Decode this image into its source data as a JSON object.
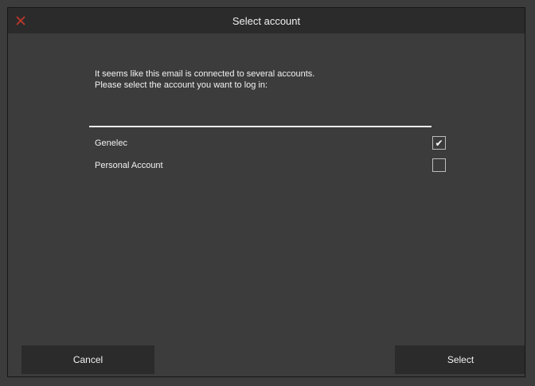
{
  "dialog": {
    "title": "Select account",
    "close_icon": "close-icon",
    "accent_close_color": "#c0392b"
  },
  "message": {
    "line1": "It seems like this email is connected to several accounts.",
    "line2": "Please select the account you want to log in:"
  },
  "accounts": [
    {
      "label": "Genelec",
      "checked": true
    },
    {
      "label": "Personal Account",
      "checked": false
    }
  ],
  "buttons": {
    "cancel_label": "Cancel",
    "select_label": "Select"
  },
  "icons": {
    "checkmark": "✔"
  }
}
